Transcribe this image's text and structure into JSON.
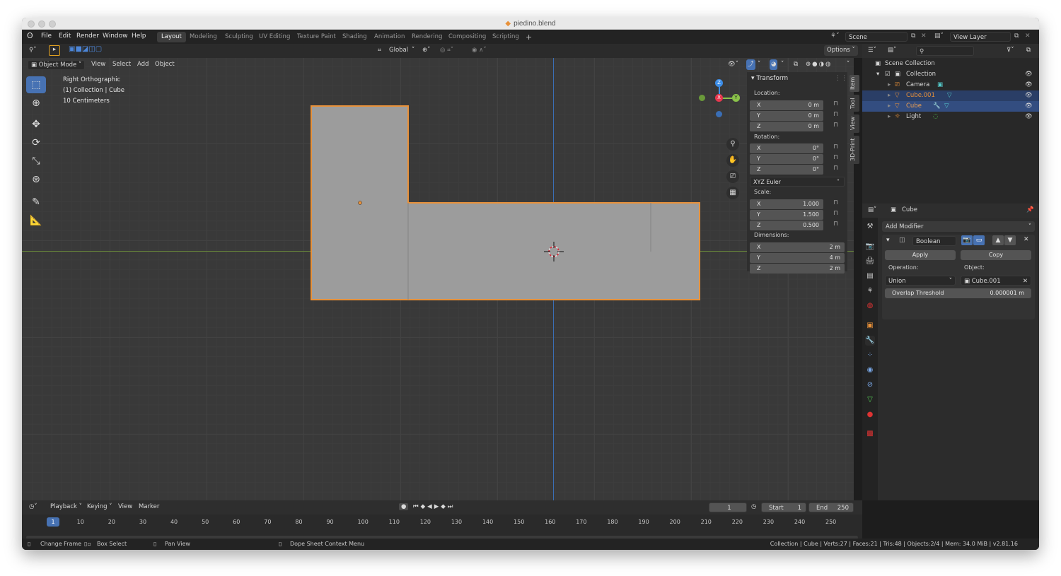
{
  "window": {
    "title": "piedino.blend"
  },
  "menu": [
    "File",
    "Edit",
    "Render",
    "Window",
    "Help"
  ],
  "workspaces": [
    "Layout",
    "Modeling",
    "Sculpting",
    "UV Editing",
    "Texture Paint",
    "Shading",
    "Animation",
    "Rendering",
    "Compositing",
    "Scripting"
  ],
  "active_workspace": "Layout",
  "scene": {
    "name": "Scene",
    "view_layer": "View Layer"
  },
  "toolheader": {
    "orientation": "Global",
    "options": "Options"
  },
  "viewport_header": {
    "mode": "Object Mode",
    "menus": [
      "View",
      "Select",
      "Add",
      "Object"
    ]
  },
  "overlay": {
    "view_name": "Right Orthographic",
    "collection_info": "(1) Collection | Cube",
    "scale": "10 Centimeters"
  },
  "gizmo": {
    "z": "Z",
    "x": "X",
    "y": "Y"
  },
  "npanel": {
    "title": "Transform",
    "location_label": "Location:",
    "location": [
      {
        "axis": "X",
        "value": "0 m"
      },
      {
        "axis": "Y",
        "value": "0 m"
      },
      {
        "axis": "Z",
        "value": "0 m"
      }
    ],
    "rotation_label": "Rotation:",
    "rotation": [
      {
        "axis": "X",
        "value": "0°"
      },
      {
        "axis": "Y",
        "value": "0°"
      },
      {
        "axis": "Z",
        "value": "0°"
      }
    ],
    "rotation_mode": "XYZ Euler",
    "scale_label": "Scale:",
    "scale": [
      {
        "axis": "X",
        "value": "1.000"
      },
      {
        "axis": "Y",
        "value": "1.500"
      },
      {
        "axis": "Z",
        "value": "0.500"
      }
    ],
    "dimensions_label": "Dimensions:",
    "dimensions": [
      {
        "axis": "X",
        "value": "2 m"
      },
      {
        "axis": "Y",
        "value": "4 m"
      },
      {
        "axis": "Z",
        "value": "2 m"
      }
    ],
    "tabs": [
      "Item",
      "Tool",
      "View",
      "3D-Print"
    ]
  },
  "outliner": {
    "root": "Scene Collection",
    "collection": "Collection",
    "items": [
      "Camera",
      "Cube.001",
      "Cube",
      "Light"
    ]
  },
  "properties": {
    "object_name": "Cube",
    "add_modifier": "Add Modifier",
    "modifier_name": "Boolean",
    "apply": "Apply",
    "copy": "Copy",
    "operation_label": "Operation:",
    "object_label": "Object:",
    "operation": "Union",
    "target_object": "Cube.001",
    "overlap_label": "Overlap Threshold",
    "overlap_value": "0.000001 m"
  },
  "timeline": {
    "menus": [
      "Playback",
      "Keying",
      "View",
      "Marker"
    ],
    "current_frame": "1",
    "start_label": "Start",
    "start": "1",
    "end_label": "End",
    "end": "250",
    "ticks": [
      "1",
      "10",
      "20",
      "30",
      "40",
      "50",
      "60",
      "70",
      "80",
      "90",
      "100",
      "110",
      "120",
      "130",
      "140",
      "150",
      "160",
      "170",
      "180",
      "190",
      "200",
      "210",
      "220",
      "230",
      "240",
      "250"
    ]
  },
  "status": {
    "change_frame": "Change Frame",
    "box_select": "Box Select",
    "pan_view": "Pan View",
    "context_menu": "Dope Sheet Context Menu",
    "stats": "Collection | Cube | Verts:27 | Faces:21 | Tris:48 | Objects:2/4 | Mem: 34.0 MiB | v2.81.16"
  },
  "colors": {
    "accent": "#4772b3",
    "selection_outline": "#e8913a",
    "x_axis": "#e8384f",
    "y_axis": "#8bc34a",
    "z_axis": "#3d8ee8"
  }
}
